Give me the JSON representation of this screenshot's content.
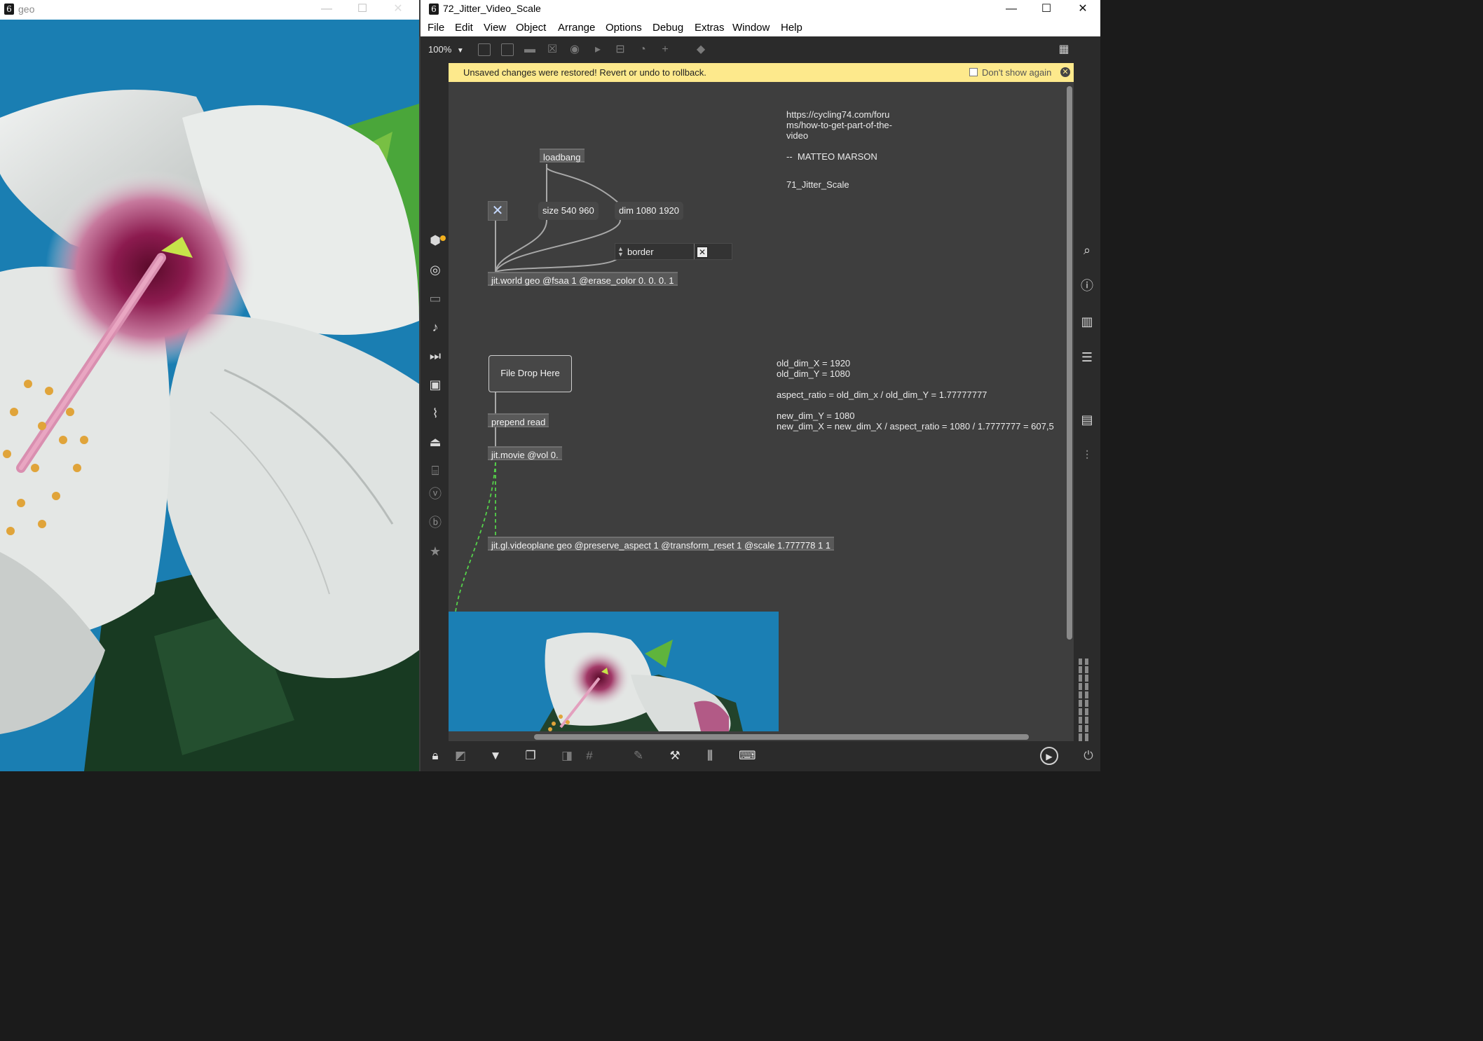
{
  "geo_window": {
    "title": "geo",
    "app_icon_glyph": "6",
    "canvas_content": "hibiscus-flower-video-frame"
  },
  "max_window": {
    "title": "72_Jitter_Video_Scale",
    "app_icon_glyph": "6",
    "menu": [
      "File",
      "Edit",
      "View",
      "Object",
      "Arrange",
      "Options",
      "Debug",
      "Extras",
      "Window",
      "Help"
    ],
    "zoom": "100%",
    "notice": {
      "message": "Unsaved changes were restored! Revert or undo to rollback.",
      "dont_show_again": "Don't show again"
    }
  },
  "patch": {
    "objects": {
      "loadbang": "loadbang",
      "size_msg": "size 540 960",
      "dim_msg": "dim 1080 1920",
      "attrui_label": "border",
      "jit_world": "jit.world geo @fsaa 1 @erase_color 0. 0. 0. 1",
      "dropfile": "File Drop Here",
      "prepend": "prepend read",
      "jit_movie": "jit.movie @vol 0.",
      "videoplane": "jit.gl.videoplane geo @preserve_aspect 1 @transform_reset 1 @scale 1.777778 1 1"
    },
    "comments": {
      "url": "https://cycling74.com/foru\nms/how-to-get-part-of-the-\nvideo",
      "author": "--  MATTEO MARSON",
      "reference": "71_Jitter_Scale",
      "math": "old_dim_X = 1920\nold_dim_Y = 1080\n\naspect_ratio = old_dim_x / old_dim_Y = 1.77777777\n\nnew_dim_Y = 1080\nnew_dim_X = new_dim_X / aspect_ratio = 1080 / 1.7777777 = 607,5"
    }
  },
  "colors": {
    "patch_bg": "#3e3e3e",
    "notice_bg": "#fde98c",
    "signal_cord": "#55d04a",
    "cord": "#a8a8a8",
    "sky_blue": "#1b7fb4"
  }
}
